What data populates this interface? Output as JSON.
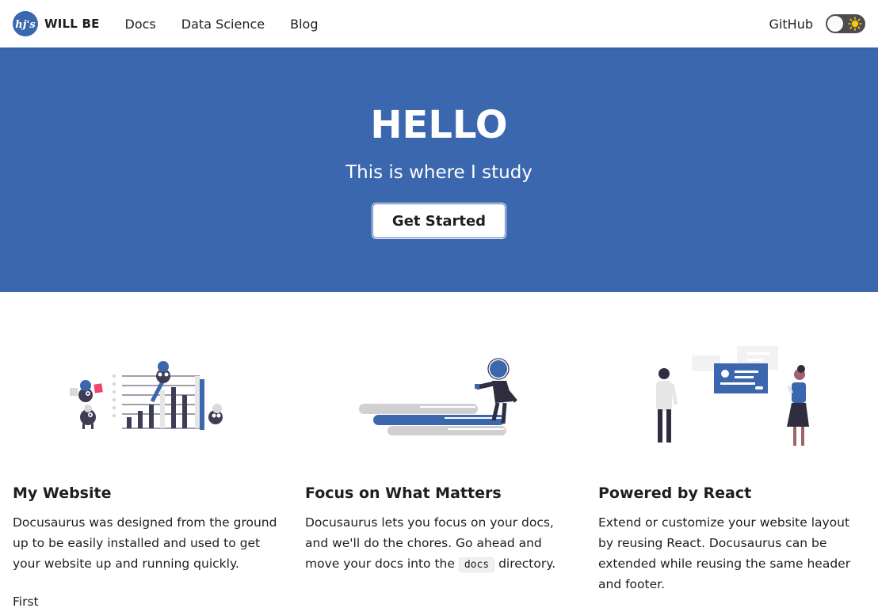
{
  "navbar": {
    "brand_title": "WILL BE",
    "logo_text": "hj's",
    "links": [
      {
        "label": "Docs"
      },
      {
        "label": "Data Science"
      },
      {
        "label": "Blog"
      }
    ],
    "github_label": "GitHub",
    "theme_toggle_icon": "sun-icon"
  },
  "hero": {
    "title": "HELLO",
    "subtitle": "This is where I study",
    "button_label": "Get Started"
  },
  "features": [
    {
      "title": "My Website",
      "description": "Docusaurus was designed from the ground up to be easily installed and used to get your website up and running quickly.",
      "illustration": "mountain-chart-illustration"
    },
    {
      "title": "Focus on What Matters",
      "description_before": "Docusaurus lets you focus on your docs, and we'll do the chores. Go ahead and move your docs into the ",
      "description_code": "docs",
      "description_after": " directory.",
      "illustration": "tree-books-illustration"
    },
    {
      "title": "Powered by React",
      "description": "Extend or customize your website layout by reusing React. Docusaurus can be extended while reusing the same header and footer.",
      "illustration": "react-people-illustration"
    }
  ],
  "footer_text": "First",
  "colors": {
    "primary": "#3a67ae",
    "text": "#1c1e21",
    "toggle": "#4d4d4d"
  }
}
